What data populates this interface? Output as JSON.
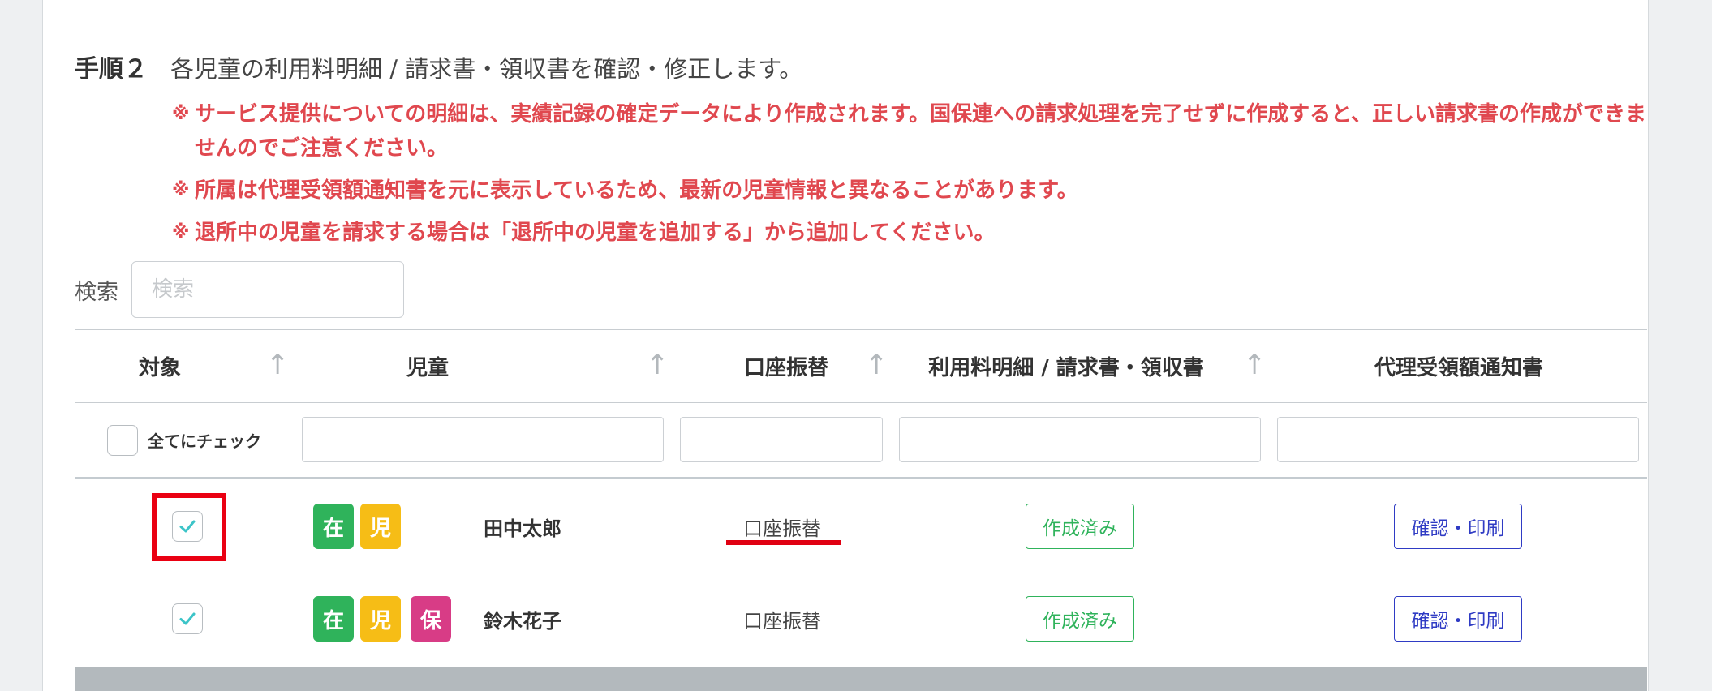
{
  "step": {
    "label": "手順２",
    "description": "各児童の利用料明細 / 請求書・領収書を確認・修正します。"
  },
  "notes": [
    {
      "mark": "※",
      "text": "サービス提供についての明細は、実績記録の確定データにより作成されます。国保連への請求処理を完了せずに作成すると、正しい請求書の作成ができませんのでご注意ください。"
    },
    {
      "mark": "※",
      "text": "所属は代理受領額通知書を元に表示しているため、最新の児童情報と異なることがあります。"
    },
    {
      "mark": "※",
      "text": "退所中の児童を請求する場合は「退所中の児童を追加する」から追加してください。"
    }
  ],
  "search": {
    "label": "検索",
    "placeholder": "検索",
    "value": ""
  },
  "table": {
    "headers": {
      "target": "対象",
      "child": "児童",
      "transfer": "口座振替",
      "statement": "利用料明細 / 請求書・領収書",
      "notice": "代理受領額通知書"
    },
    "sort_icon": "↑",
    "check_all_label": "全てにチェック",
    "rows": [
      {
        "checked": true,
        "badges": [
          "在",
          "児"
        ],
        "name": "田中太郎",
        "transfer": "口座振替",
        "statement_button": "作成済み",
        "notice_button": "確認・印刷"
      },
      {
        "checked": true,
        "badges": [
          "在",
          "児",
          "保"
        ],
        "name": "鈴木花子",
        "transfer": "口座振替",
        "statement_button": "作成済み",
        "notice_button": "確認・印刷"
      }
    ]
  },
  "colors": {
    "note_red": "#e0484f",
    "badge_green": "#2fb35b",
    "badge_yellow": "#f6bd16",
    "badge_pink": "#d83c86",
    "confirm_blue": "#2f3bc4",
    "checkmark": "#3cc4c8",
    "highlight_red": "#ea0012"
  }
}
